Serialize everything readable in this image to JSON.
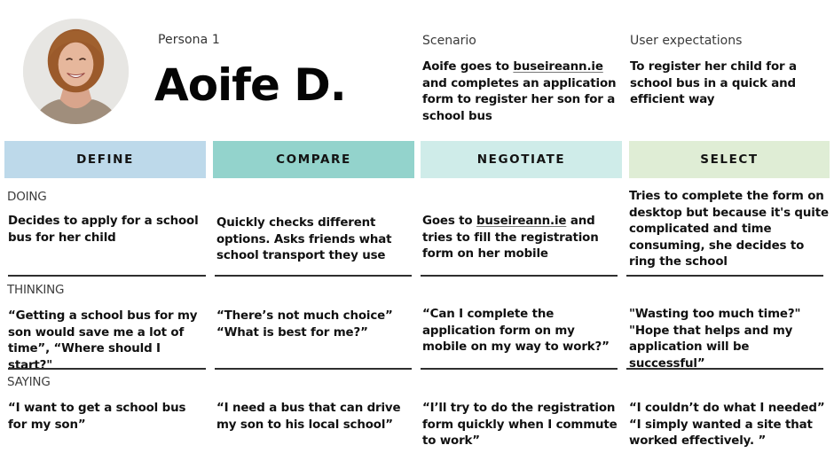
{
  "persona": {
    "label": "Persona 1",
    "name": "Aoife D.",
    "photo": "smiling-woman-portrait"
  },
  "scenario": {
    "title": "Scenario",
    "text_before_link": "Aoife goes to ",
    "link": "buseireann.ie",
    "text_after_link": " and completes an application form to register her son for a school bus"
  },
  "expectations": {
    "title": "User expectations",
    "text": "To register her child for a school bus in a quick and efficient way"
  },
  "stages": [
    {
      "label": "DEFINE",
      "color": "#bdd9ea"
    },
    {
      "label": "COMPARE",
      "color": "#93d3cc"
    },
    {
      "label": "NEGOTIATE",
      "color": "#cfece9"
    },
    {
      "label": "SELECT",
      "color": "#dfedd5"
    }
  ],
  "rows": {
    "doing": {
      "label": "DOING",
      "cells": [
        {
          "text": "Decides to apply for a school bus for her child"
        },
        {
          "text": "Quickly checks different options. Asks friends what school transport they use"
        },
        {
          "text_before_link": "Goes to ",
          "link": "buseireann.ie",
          "text_after_link": " and tries to fill the registration form on her mobile"
        },
        {
          "text": "Tries to complete the form on desktop but because it's quite complicated and time consuming, she decides to ring the school"
        }
      ]
    },
    "thinking": {
      "label": "THINKING",
      "cells": [
        {
          "lines": [
            "“Getting a school bus for my son would save me a lot of time”, “Where should I start?\""
          ]
        },
        {
          "lines": [
            "“There’s not much choice”",
            "“What is best for me?”"
          ]
        },
        {
          "lines": [
            "“Can I complete the application form on my mobile on my way to work?”"
          ]
        },
        {
          "lines": [
            "\"Wasting too much time?\"",
            "\"Hope that helps and my application will be successful”"
          ]
        }
      ]
    },
    "saying": {
      "label": "SAYING",
      "cells": [
        {
          "lines": [
            "“I want to get a school bus for my son”"
          ]
        },
        {
          "lines": [
            "“I need a bus that can drive my son to his local school”"
          ]
        },
        {
          "lines": [
            "“I’ll try to do the registration form quickly when I commute to work”"
          ]
        },
        {
          "lines": [
            "“I couldn’t do what I needed”",
            "“I simply wanted a site that worked effectively. ”"
          ]
        }
      ]
    }
  }
}
